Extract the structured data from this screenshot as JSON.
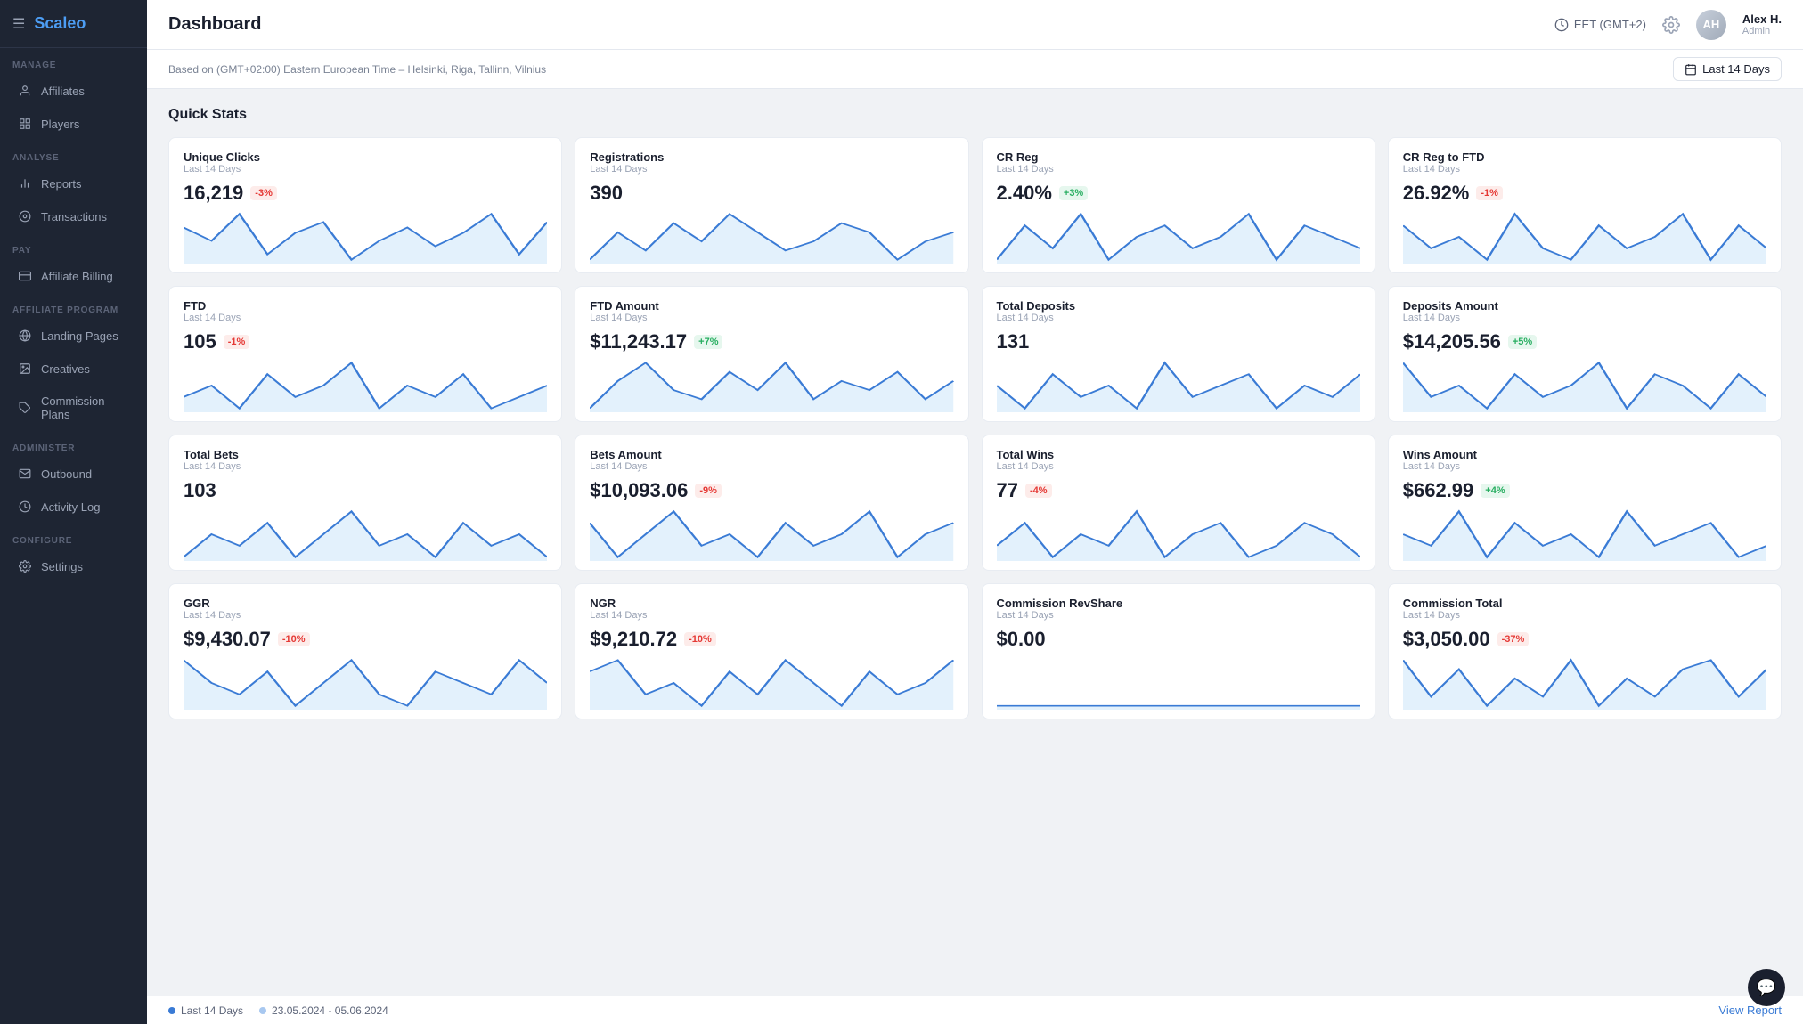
{
  "brand": "Scaleo",
  "sidebar": {
    "sections": [
      {
        "label": "MANAGE",
        "items": [
          {
            "id": "affiliates",
            "label": "Affiliates",
            "icon": "person"
          },
          {
            "id": "players",
            "label": "Players",
            "icon": "grid"
          }
        ]
      },
      {
        "label": "ANALYSE",
        "items": [
          {
            "id": "reports",
            "label": "Reports",
            "icon": "bar-chart"
          },
          {
            "id": "transactions",
            "label": "Transactions",
            "icon": "circle-dot"
          }
        ]
      },
      {
        "label": "PAY",
        "items": [
          {
            "id": "affiliate-billing",
            "label": "Affiliate Billing",
            "icon": "credit-card"
          }
        ]
      },
      {
        "label": "AFFILIATE PROGRAM",
        "items": [
          {
            "id": "landing-pages",
            "label": "Landing Pages",
            "icon": "globe"
          },
          {
            "id": "creatives",
            "label": "Creatives",
            "icon": "image"
          },
          {
            "id": "commission-plans",
            "label": "Commission Plans",
            "icon": "tag"
          }
        ]
      },
      {
        "label": "ADMINISTER",
        "items": [
          {
            "id": "outbound",
            "label": "Outbound",
            "icon": "mail"
          },
          {
            "id": "activity-log",
            "label": "Activity Log",
            "icon": "clock"
          }
        ]
      },
      {
        "label": "CONFIGURE",
        "items": [
          {
            "id": "settings",
            "label": "Settings",
            "icon": "gear"
          }
        ]
      }
    ]
  },
  "topbar": {
    "page_title": "Dashboard",
    "timezone": "EET (GMT+2)",
    "user_name": "Alex H.",
    "user_role": "Admin"
  },
  "subbar": {
    "timezone_label": "Based on (GMT+02:00) Eastern European Time – Helsinki, Riga, Tallinn, Vilnius",
    "date_range": "Last 14 Days"
  },
  "quick_stats_title": "Quick Stats",
  "stats": [
    {
      "label": "Unique Clicks",
      "period": "Last 14 Days",
      "value": "16,219",
      "badge": "-3%",
      "badge_type": "red",
      "chart_id": "chart1"
    },
    {
      "label": "Registrations",
      "period": "Last 14 Days",
      "value": "390",
      "badge": null,
      "badge_type": null,
      "chart_id": "chart2"
    },
    {
      "label": "CR Reg",
      "period": "Last 14 Days",
      "value": "2.40%",
      "badge": "+3%",
      "badge_type": "green",
      "chart_id": "chart3"
    },
    {
      "label": "CR Reg to FTD",
      "period": "Last 14 Days",
      "value": "26.92%",
      "badge": "-1%",
      "badge_type": "red",
      "chart_id": "chart4"
    },
    {
      "label": "FTD",
      "period": "Last 14 Days",
      "value": "105",
      "badge": "-1%",
      "badge_type": "red",
      "chart_id": "chart5"
    },
    {
      "label": "FTD Amount",
      "period": "Last 14 Days",
      "value": "$11,243.17",
      "badge": "+7%",
      "badge_type": "green",
      "chart_id": "chart6"
    },
    {
      "label": "Total Deposits",
      "period": "Last 14 Days",
      "value": "131",
      "badge": null,
      "badge_type": null,
      "chart_id": "chart7"
    },
    {
      "label": "Deposits Amount",
      "period": "Last 14 Days",
      "value": "$14,205.56",
      "badge": "+5%",
      "badge_type": "green",
      "chart_id": "chart8"
    },
    {
      "label": "Total Bets",
      "period": "Last 14 Days",
      "value": "103",
      "badge": null,
      "badge_type": null,
      "chart_id": "chart9"
    },
    {
      "label": "Bets Amount",
      "period": "Last 14 Days",
      "value": "$10,093.06",
      "badge": "-9%",
      "badge_type": "red",
      "chart_id": "chart10"
    },
    {
      "label": "Total Wins",
      "period": "Last 14 Days",
      "value": "77",
      "badge": "-4%",
      "badge_type": "red",
      "chart_id": "chart11"
    },
    {
      "label": "Wins Amount",
      "period": "Last 14 Days",
      "value": "$662.99",
      "badge": "+4%",
      "badge_type": "green",
      "chart_id": "chart12"
    },
    {
      "label": "GGR",
      "period": "Last 14 Days",
      "value": "$9,430.07",
      "badge": "-10%",
      "badge_type": "red",
      "chart_id": "chart13"
    },
    {
      "label": "NGR",
      "period": "Last 14 Days",
      "value": "$9,210.72",
      "badge": "-10%",
      "badge_type": "red",
      "chart_id": "chart14"
    },
    {
      "label": "Commission RevShare",
      "period": "Last 14 Days",
      "value": "$0.00",
      "badge": null,
      "badge_type": null,
      "chart_id": "chart15"
    },
    {
      "label": "Commission Total",
      "period": "Last 14 Days",
      "value": "$3,050.00",
      "badge": "-37%",
      "badge_type": "red",
      "chart_id": "chart16"
    }
  ],
  "footer": {
    "legend_items": [
      {
        "label": "Last 14 Days",
        "color": "blue"
      },
      {
        "label": "23.05.2024 - 05.06.2024",
        "color": "lightblue"
      }
    ],
    "view_report": "View Report"
  }
}
